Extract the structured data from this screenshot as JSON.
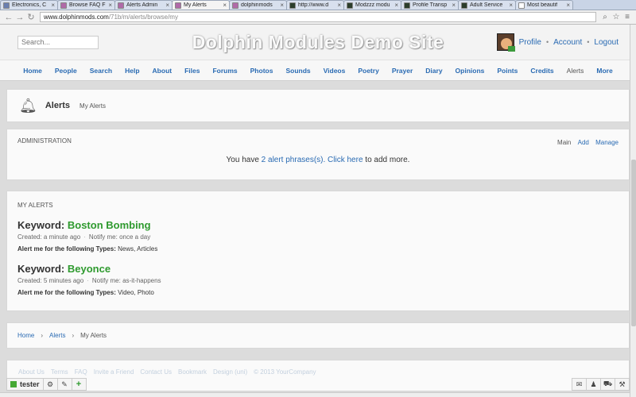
{
  "browser": {
    "tabs": [
      {
        "title": "Electronics, C",
        "color": "#6a7fb0",
        "active": false
      },
      {
        "title": "Browse FAQ F",
        "color": "#b06aa8",
        "active": false
      },
      {
        "title": "Alerts Admin",
        "color": "#b06aa8",
        "active": false
      },
      {
        "title": "My Alerts",
        "color": "#b06aa8",
        "active": true
      },
      {
        "title": "dolphinmods",
        "color": "#b06aa8",
        "active": false
      },
      {
        "title": "http://www.d",
        "color": "#2c3e2c",
        "active": false
      },
      {
        "title": "Modzzz modu",
        "color": "#2c3e2c",
        "active": false
      },
      {
        "title": "Profile Transp",
        "color": "#2c3e2c",
        "active": false
      },
      {
        "title": "Adult Service",
        "color": "#2c3e2c",
        "active": false
      },
      {
        "title": "Most beautif",
        "color": "#ffffff",
        "active": false
      }
    ],
    "url_host": "www.dolphinmods.com",
    "url_path": "/71b/m/alerts/browse/my"
  },
  "header": {
    "search_placeholder": "Search...",
    "site_title": "Dolphin Modules Demo Site",
    "user_links": [
      "Profile",
      "Account",
      "Logout"
    ]
  },
  "nav": {
    "items": [
      "Home",
      "People",
      "Search",
      "Help",
      "About",
      "Files",
      "Forums",
      "Photos",
      "Sounds",
      "Videos",
      "Poetry",
      "Prayer",
      "Diary",
      "Opinions",
      "Points",
      "Credits",
      "Alerts",
      "More"
    ],
    "active": "Alerts"
  },
  "alerts_head": {
    "title": "Alerts",
    "sub": "My Alerts"
  },
  "admin": {
    "caption": "ADMINISTRATION",
    "links": {
      "main": "Main",
      "add": "Add",
      "manage": "Manage"
    },
    "msg_prefix": "You have",
    "msg_link": "2 alert phrases(s).",
    "msg_click": "Click here",
    "msg_suffix": "to add more."
  },
  "my_alerts": {
    "caption": "MY ALERTS",
    "keyword_label": "Keyword:",
    "types_label": "Alert me for the following Types:",
    "items": [
      {
        "keyword": "Boston Bombing",
        "created": "Created: a minute ago",
        "notify": "Notify me: once a day",
        "types": "News, Articles"
      },
      {
        "keyword": "Beyonce",
        "created": "Created: 5 minutes ago",
        "notify": "Notify me: as-it-happens",
        "types": "Video, Photo"
      }
    ]
  },
  "breadcrumb": {
    "home": "Home",
    "alerts": "Alerts",
    "current": "My Alerts"
  },
  "footer": {
    "links": [
      "About Us",
      "Terms",
      "FAQ",
      "Invite a Friend",
      "Contact Us",
      "Bookmark",
      "Design (uni)",
      "© 2013 YourCompany"
    ]
  },
  "toolbar": {
    "username": "tester"
  }
}
